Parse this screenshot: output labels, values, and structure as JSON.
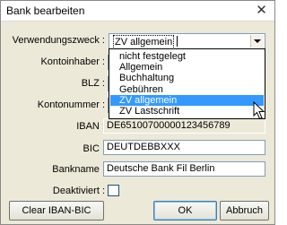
{
  "window": {
    "title": "Bank bearbeiten",
    "close_glyph": "✕"
  },
  "form": {
    "verwendungszweck_label": "Verwendungszweck :",
    "verwendungszweck_value": "ZV allgemein",
    "kontoinhaber_label": "Kontoinhaber :",
    "blz_label": "BLZ :",
    "kontonummer_label": "Kontonummer :",
    "iban_label": "IBAN :",
    "iban_value": "DE65100700000123456789",
    "bic_label": "BIC :",
    "bic_value": "DEUTDEBBXXX",
    "bankname_label": "Bankname :",
    "bankname_value": "Deutsche Bank Fil Berlin",
    "deaktiviert_label": "Deaktiviert :",
    "deaktiviert_checked": false
  },
  "dropdown": {
    "options": [
      "nicht festgelegt",
      "Allgemein",
      "Buchhaltung",
      "Gebühren",
      "ZV allgemein",
      "ZV Lastschrift"
    ],
    "selected_index": 4
  },
  "buttons": {
    "clear_label": "Clear IBAN-BIC",
    "ok_label": "OK",
    "cancel_label": "Abbruch"
  },
  "colors": {
    "selection": "#3399ff",
    "dialog_bg": "#ece9d8"
  }
}
